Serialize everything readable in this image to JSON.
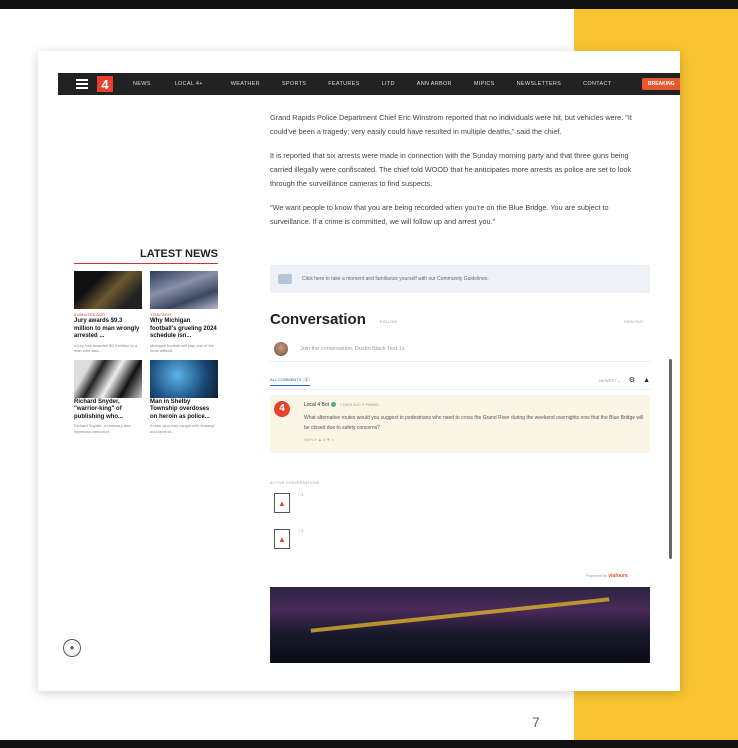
{
  "slide": {
    "page_number": "7"
  },
  "nav": {
    "logo": "4",
    "items": [
      "NEWS",
      "LOCAL 4+",
      "WEATHER",
      "SPORTS",
      "FEATURES",
      "LITD",
      "ANN ARBOR",
      "MIPICS",
      "NEWSLETTERS",
      "CONTACT"
    ],
    "breaking": "BREAKING"
  },
  "article": {
    "p1": "Grand Rapids Police Department Chief Eric Winstrom reported that no individuals were hit, but vehicles were. \"It could've been a tragedy; very easily could have resulted in multiple deaths,\" said the chief.",
    "p2": "It is reported that six arrests were made in connection with the Sunday morning party and that three guns being carried illegally were confiscated. The chief told WOOD that he anticipates more arrests as police are set to look through the surveillance cameras to find suspects.",
    "p3": "\"We want people to know that you are being recorded when you're on the Blue Bridge. You are subject to surveillance. If a crime is committed, we will follow up and arrest you.\""
  },
  "latest_news": {
    "title": "LATEST NEWS",
    "items": [
      {
        "time": "8 MINUTES AGO",
        "headline": "Jury awards $9.3 million to man wrongly arrested ...",
        "desc": "A jury has awarded $9.3 million to a man who was..."
      },
      {
        "time": "1 DAY AGO",
        "headline": "Why Michigan football's grueling 2024 schedule isn...",
        "desc": "Michigan football will play one of the most difficult..."
      },
      {
        "time": "",
        "headline": "Richard Snyder, \"warrior-king\" of publishing who...",
        "desc": "Richard Snyder, a visionary and imperious executive..."
      },
      {
        "time": "",
        "headline": "Man in Shelby Township overdoses on heroin as police...",
        "desc": "A man who was caught with fentanyl and several..."
      }
    ]
  },
  "guidelines": {
    "text": "Click here to take a moment and familiarize yourself with our Community Guidelines."
  },
  "conversation": {
    "title": "Conversation",
    "follow": "FOLLOW",
    "signout": "SIGN OUT",
    "join_placeholder": "Join the conversation, Dustin Black Test 1s",
    "tab_all": "ALL COMMENTS",
    "tab_count": "1",
    "sort": "NEWEST",
    "comment": {
      "avatar": "4",
      "author": "Local 4 Bot",
      "meta": "7 DAYS AGO  ✦  PINNED",
      "text": "What alternative routes would you suggest to pedestrians who need to cross the Grand River during the weekend overnights now that the Blue Bridge will be closed due to safety concerns?",
      "actions": "REPLY   ▲ 0   ▼ 0"
    },
    "active_label": "ACTIVE CONVERSATIONS",
    "active_counts": [
      "1",
      "1"
    ],
    "powered_by": "Powered by",
    "brand": "viafoura"
  },
  "colors": {
    "accent": "#e8412e",
    "yellow": "#f7c331",
    "nav": "#222222"
  }
}
